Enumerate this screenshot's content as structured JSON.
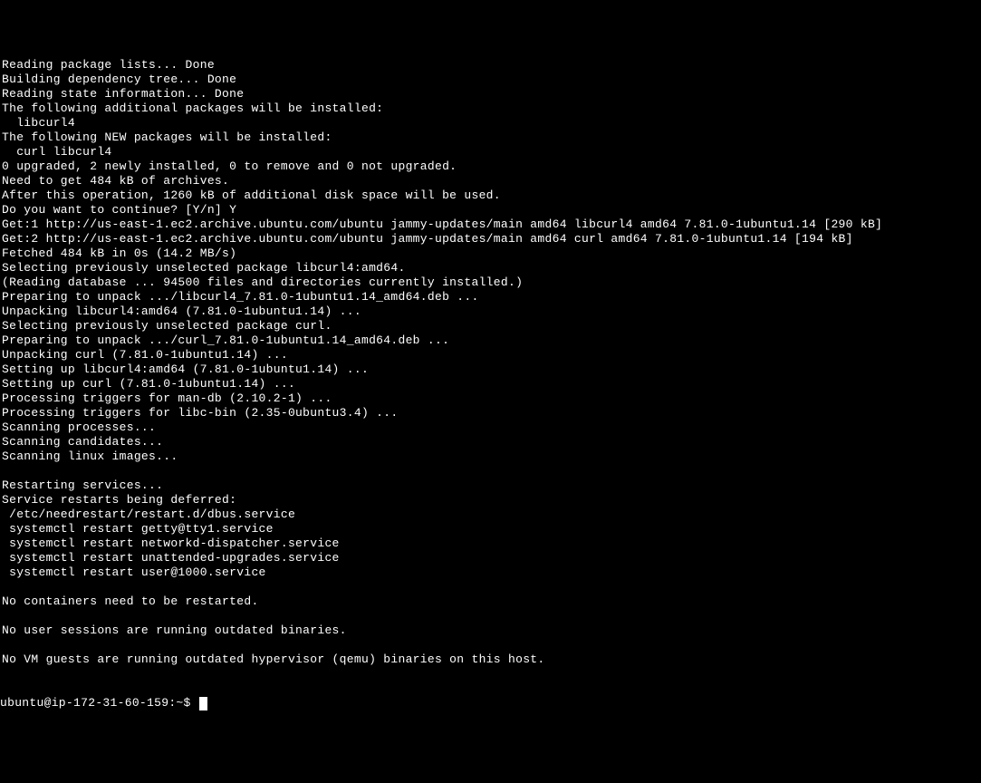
{
  "lines": [
    "Reading package lists... Done",
    "Building dependency tree... Done",
    "Reading state information... Done",
    "The following additional packages will be installed:",
    "  libcurl4",
    "The following NEW packages will be installed:",
    "  curl libcurl4",
    "0 upgraded, 2 newly installed, 0 to remove and 0 not upgraded.",
    "Need to get 484 kB of archives.",
    "After this operation, 1260 kB of additional disk space will be used.",
    "Do you want to continue? [Y/n] Y",
    "Get:1 http://us-east-1.ec2.archive.ubuntu.com/ubuntu jammy-updates/main amd64 libcurl4 amd64 7.81.0-1ubuntu1.14 [290 kB]",
    "Get:2 http://us-east-1.ec2.archive.ubuntu.com/ubuntu jammy-updates/main amd64 curl amd64 7.81.0-1ubuntu1.14 [194 kB]",
    "Fetched 484 kB in 0s (14.2 MB/s)",
    "Selecting previously unselected package libcurl4:amd64.",
    "(Reading database ... 94500 files and directories currently installed.)",
    "Preparing to unpack .../libcurl4_7.81.0-1ubuntu1.14_amd64.deb ...",
    "Unpacking libcurl4:amd64 (7.81.0-1ubuntu1.14) ...",
    "Selecting previously unselected package curl.",
    "Preparing to unpack .../curl_7.81.0-1ubuntu1.14_amd64.deb ...",
    "Unpacking curl (7.81.0-1ubuntu1.14) ...",
    "Setting up libcurl4:amd64 (7.81.0-1ubuntu1.14) ...",
    "Setting up curl (7.81.0-1ubuntu1.14) ...",
    "Processing triggers for man-db (2.10.2-1) ...",
    "Processing triggers for libc-bin (2.35-0ubuntu3.4) ...",
    "Scanning processes...",
    "Scanning candidates...",
    "Scanning linux images...",
    "",
    "Restarting services...",
    "Service restarts being deferred:",
    " /etc/needrestart/restart.d/dbus.service",
    " systemctl restart getty@tty1.service",
    " systemctl restart networkd-dispatcher.service",
    " systemctl restart unattended-upgrades.service",
    " systemctl restart user@1000.service",
    "",
    "No containers need to be restarted.",
    "",
    "No user sessions are running outdated binaries.",
    "",
    "No VM guests are running outdated hypervisor (qemu) binaries on this host."
  ],
  "prompt": "ubuntu@ip-172-31-60-159:~$ "
}
